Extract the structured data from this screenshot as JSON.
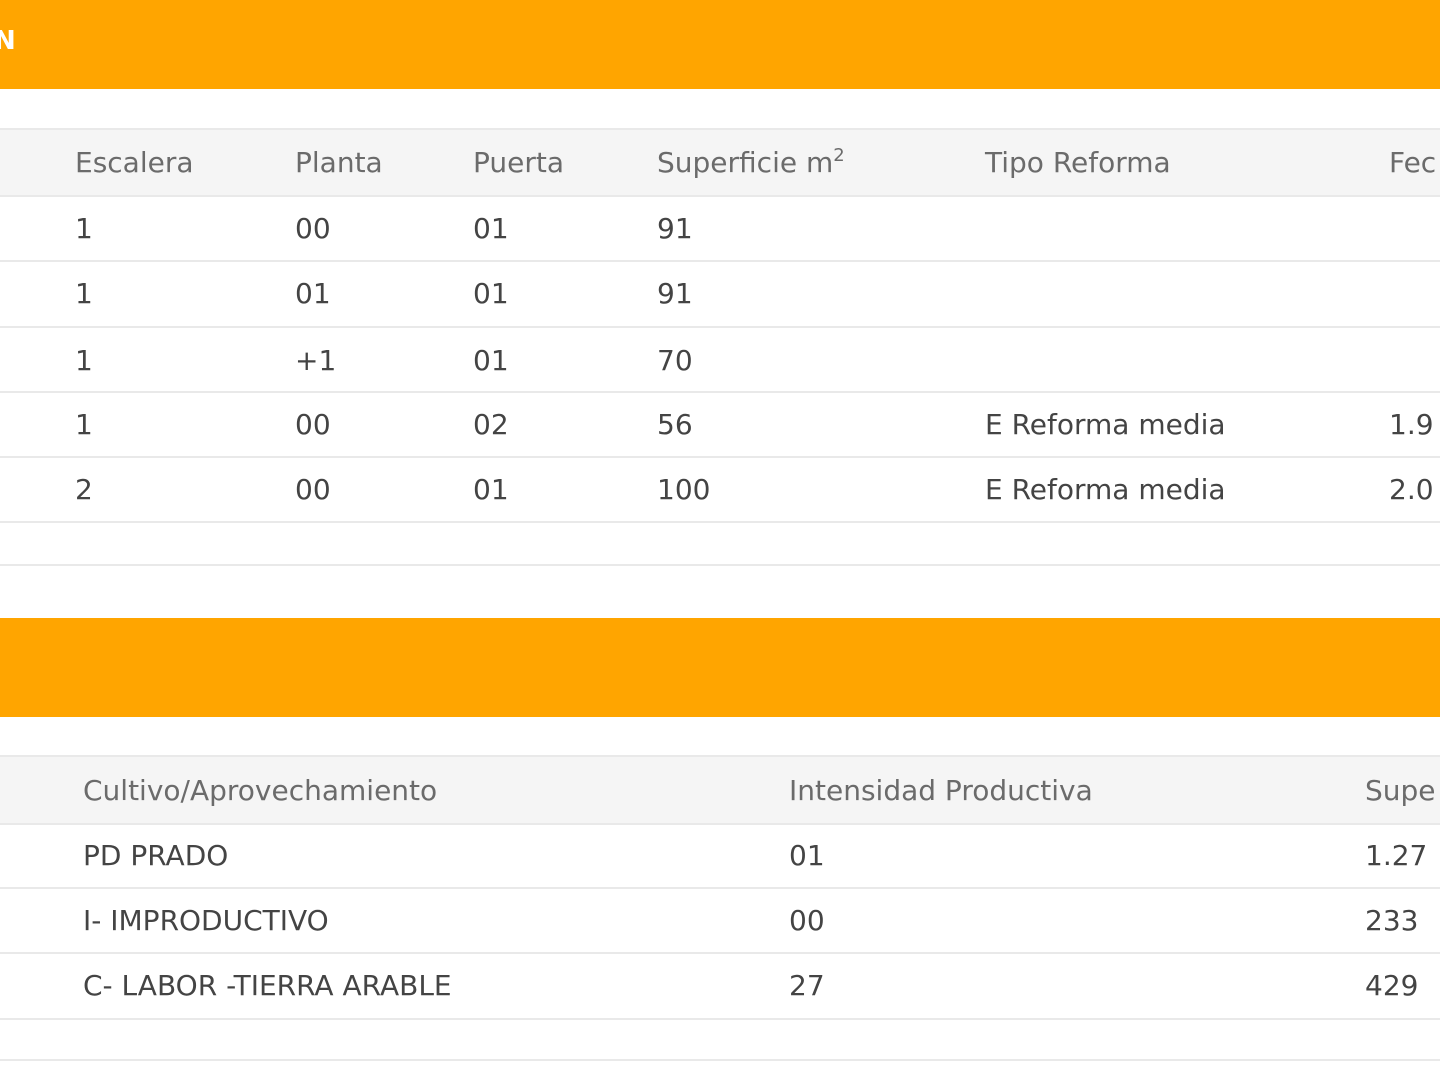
{
  "sections": {
    "construcciones": {
      "title_fragment": "N"
    }
  },
  "table1": {
    "headers": [
      "Escalera",
      "Planta",
      "Puerta",
      "Superficie m",
      "Tipo Reforma",
      "Fec"
    ],
    "superficie_sup": "2",
    "rows": [
      [
        "1",
        "00",
        "01",
        "91",
        "",
        ""
      ],
      [
        "1",
        "01",
        "01",
        "91",
        "",
        ""
      ],
      [
        "1",
        "+1",
        "01",
        "70",
        "",
        ""
      ],
      [
        "1",
        "00",
        "02",
        "56",
        "E Reforma media",
        "1.9"
      ],
      [
        "2",
        "00",
        "01",
        "100",
        "E Reforma media",
        "2.0"
      ]
    ]
  },
  "table2": {
    "headers": [
      "Cultivo/Aprovechamiento",
      "Intensidad Productiva",
      "Supe"
    ],
    "rows": [
      [
        "PD PRADO",
        "01",
        "1.27"
      ],
      [
        "I- IMPRODUCTIVO",
        "00",
        "233"
      ],
      [
        "C- LABOR -TIERRA ARABLE",
        "27",
        "429"
      ]
    ]
  },
  "colors": {
    "accent": "#ffa500",
    "header_bg": "#f5f5f5",
    "row_line": "#e9e9e9"
  }
}
